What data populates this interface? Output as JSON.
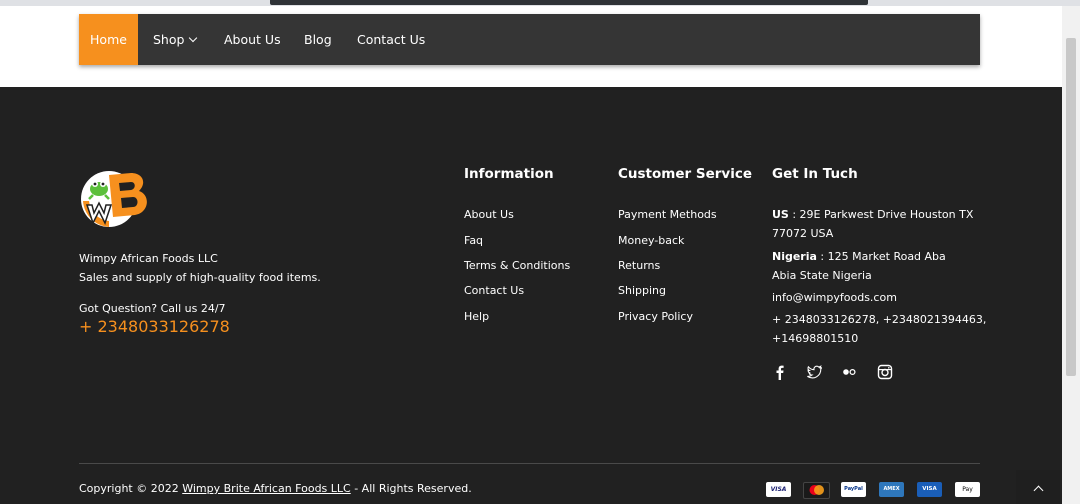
{
  "nav": {
    "items": [
      {
        "label": "Home",
        "active": true
      },
      {
        "label": "Shop",
        "has_dropdown": true
      },
      {
        "label": "About Us"
      },
      {
        "label": "Blog"
      },
      {
        "label": "Contact Us"
      }
    ],
    "accent_color": "#f6901e",
    "bg_color": "#353535"
  },
  "footer": {
    "logo_text": "WB",
    "company_name": "Wimpy African Foods LLC",
    "tagline": "Sales and supply of high-quality food items.",
    "call_label": "Got Question? Call us 24/7",
    "phone": "+ 2348033126278",
    "information": {
      "title": "Information",
      "links": [
        "About Us",
        "Faq",
        "Terms & Conditions",
        "Contact Us",
        "Help"
      ]
    },
    "customer_service": {
      "title": "Customer Service",
      "links": [
        "Payment Methods",
        "Money-back",
        "Returns",
        "Shipping",
        "Privacy Policy"
      ]
    },
    "get_in_touch": {
      "title": "Get In Tuch",
      "us_label": "US",
      "us_address_line1": " : 29E Parkwest Drive Houston TX",
      "us_address_line2": "77072 USA",
      "nigeria_label": "Nigeria",
      "nigeria_address_line1": " : 125 Market Road Aba",
      "nigeria_address_line2": "Abia State Nigeria",
      "email": "info@wimpyfoods.com",
      "phones_line1": "+ 2348033126278, +2348021394463,",
      "phones_line2": "+14698801510"
    },
    "social_icons": [
      "facebook-icon",
      "twitter-icon",
      "flickr-icon",
      "instagram-icon"
    ],
    "copyright_prefix": "Copyright © 2022 ",
    "copyright_link": "Wimpy Brite African Foods LLC",
    "copyright_suffix": " - All Rights Reserved.",
    "payment_methods": [
      "VISA",
      "mastercard",
      "PayPal",
      "AMEX",
      "VISA",
      "Pay"
    ],
    "bg_color": "#212121"
  }
}
